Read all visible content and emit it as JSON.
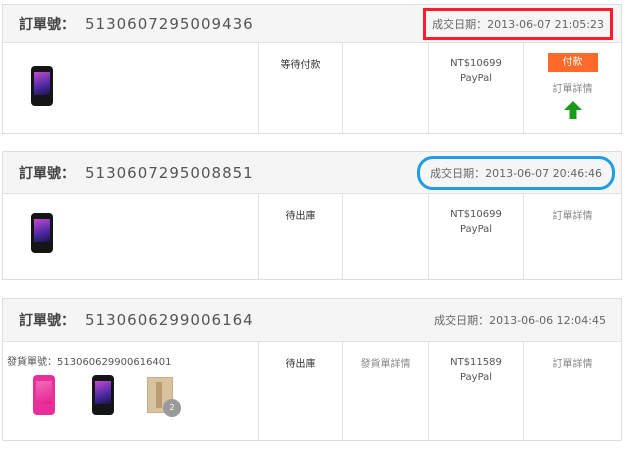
{
  "labels": {
    "order_no": "訂單號：",
    "date": "成交日期：",
    "waybill": "發貨單號：",
    "ship_detail": "發貨單詳情",
    "order_detail": "訂單詳情",
    "pay": "付款"
  },
  "orders": [
    {
      "number": "5130607295009436",
      "date": "2013-06-07 21:05:23",
      "status": "等待付款",
      "price": "NT$10699",
      "payment": "PayPal",
      "highlight_color": "#ff1c2c"
    },
    {
      "number": "5130607295008851",
      "date": "2013-06-07 20:46:46",
      "status": "待出庫",
      "price": "NT$10699",
      "payment": "PayPal",
      "highlight_color": "#1f9de0"
    },
    {
      "number": "5130606299006164",
      "date": "2013-06-06 12:04:45",
      "status": "待出庫",
      "waybill_no": "513060629900616401",
      "price": "NT$11589",
      "payment": "PayPal",
      "more_count": "2"
    }
  ],
  "icons": {
    "arrow": "up-arrow-icon",
    "arrow_color": "#1a9a1a",
    "pay_button_color": "#ff6a2b"
  }
}
